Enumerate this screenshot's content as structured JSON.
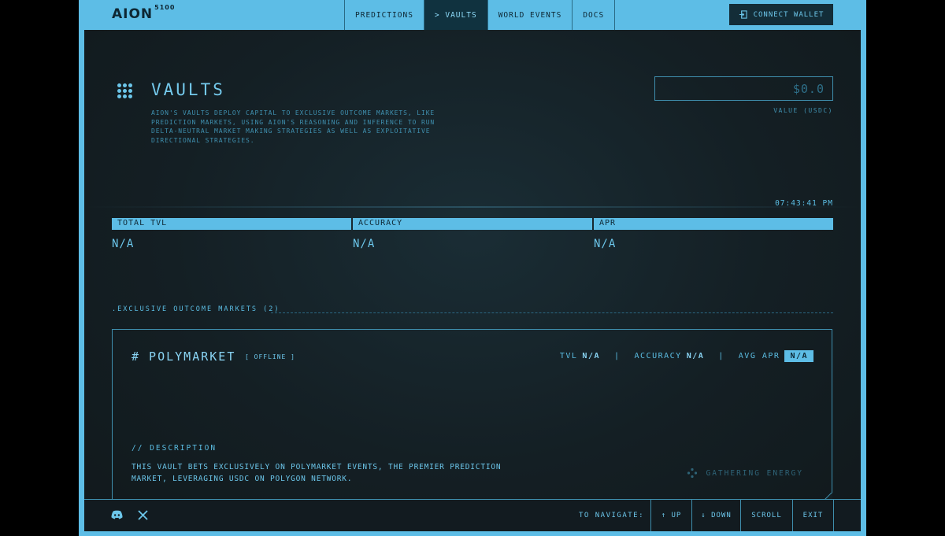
{
  "header": {
    "logo": "AION",
    "logo_sup": "5100",
    "tabs": [
      {
        "label": "PREDICTIONS",
        "active": false
      },
      {
        "label": "> VAULTS",
        "active": true
      },
      {
        "label": "WORLD EVENTS",
        "active": false
      },
      {
        "label": "DOCS",
        "active": false
      }
    ],
    "wallet_label": "CONNECT WALLET"
  },
  "page": {
    "title": "VAULTS",
    "description": "AION'S VAULTS DEPLOY CAPITAL TO EXCLUSIVE OUTCOME MARKETS, LIKE PREDICTION MARKETS, USING AION'S REASONING AND INFERENCE TO RUN DELTA-NEUTRAL MARKET MAKING STRATEGIES AS WELL AS EXPLOITATIVE DIRECTIONAL STRATEGIES.",
    "value": "$0.0",
    "value_label": "VALUE (USDC)",
    "clock": "07:43:41 PM"
  },
  "stats": [
    {
      "label": "TOTAL TVL",
      "value": "N/A"
    },
    {
      "label": "ACCURACY",
      "value": "N/A"
    },
    {
      "label": "APR",
      "value": "N/A"
    }
  ],
  "section": {
    "label": ".EXCLUSIVE OUTCOME MARKETS (2)"
  },
  "card": {
    "title": "# POLYMARKET",
    "status": "[ OFFLINE ]",
    "tvl_label": "TVL",
    "tvl_value": "N/A",
    "sep1": "|",
    "accuracy_label": "ACCURACY",
    "accuracy_value": "N/A",
    "sep2": "|",
    "apr_label": "AVG APR",
    "apr_value": "N/A",
    "desc_label": "// DESCRIPTION",
    "desc_text": "THIS VAULT BETS EXCLUSIVELY ON POLYMARKET EVENTS, THE PREMIER PREDICTION MARKET, LEVERAGING USDC ON POLYGON NETWORK.",
    "energy_label": "GATHERING ENERGY"
  },
  "footer": {
    "social_icons": [
      "discord-icon",
      "x-icon"
    ],
    "nav_label": "TO NAVIGATE:",
    "keys": [
      "↑ UP",
      "↓ DOWN",
      "SCROLL",
      "EXIT"
    ]
  },
  "colors": {
    "accent": "#5dbde6",
    "panel_bg": "#141f24",
    "text": "#5bbde3",
    "dark_text": "#0e2733"
  }
}
